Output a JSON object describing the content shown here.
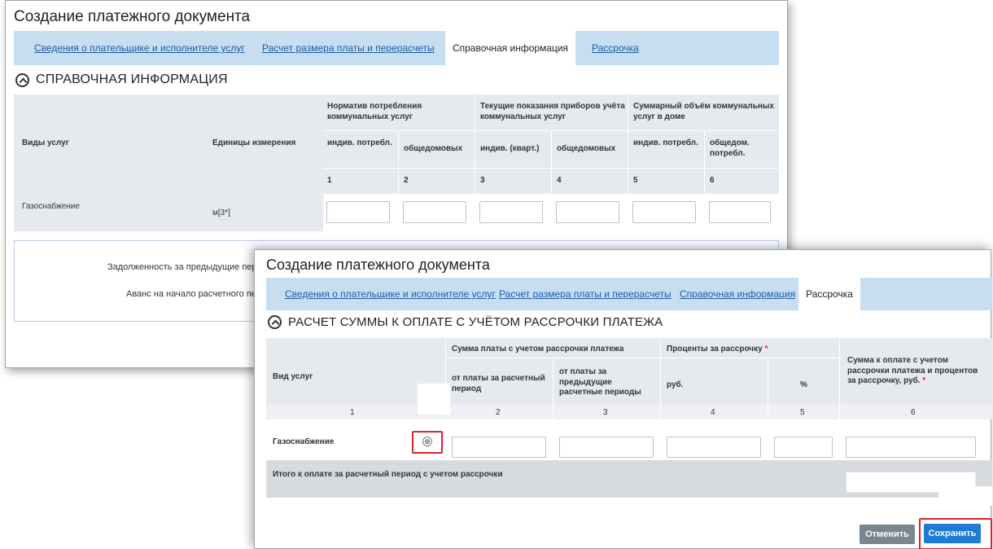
{
  "window_back": {
    "title": "Создание платежного документа",
    "tabs": [
      {
        "label": "Сведения о плательщике и исполнителе услуг",
        "active": false
      },
      {
        "label": "Расчет размера платы и перерасчеты",
        "active": false
      },
      {
        "label": "Справочная информация",
        "active": true
      },
      {
        "label": "Рассрочка",
        "active": false
      }
    ],
    "section_title": "СПРАВОЧНАЯ ИНФОРМАЦИЯ",
    "table": {
      "col_service": "Виды услуг",
      "col_units": "Единицы измерения",
      "group_norm": "Норматив потребления коммунальных услуг",
      "group_current": "Текущие показания приборов учёта коммунальных услуг",
      "group_total": "Суммарный объём коммунальных услуг в доме",
      "sub": [
        "индив. потребл.",
        "общедомовых",
        "индив. (кварт.)",
        "общедомовых",
        "индив. потребл.",
        "общедом. потребл."
      ],
      "nums": [
        "1",
        "2",
        "3",
        "4",
        "5",
        "6"
      ],
      "row_service": "Газоснабжение",
      "row_unit": "м[3*]"
    },
    "debt_label": "Задолженность за предыдущие перио",
    "advance_label": "Аванс на начало расчетного пери"
  },
  "window_front": {
    "title": "Создание платежного документа",
    "tabs": [
      {
        "label": "Сведения о плательщике и исполнителе услуг",
        "active": false
      },
      {
        "label": "Расчет размера платы и перерасчеты",
        "active": false
      },
      {
        "label": "Справочная информация",
        "active": false
      },
      {
        "label": "Рассрочка",
        "active": true
      }
    ],
    "section_title": "РАСЧЕТ СУММЫ К ОПЛАТЕ С УЧЁТОМ РАССРОЧКИ ПЛАТЕЖА",
    "table": {
      "col_service": "Вид услуг",
      "group_sum": "Сумма платы с учетом рассрочки платежа",
      "sub_current": "от платы за расчетный период",
      "sub_prev": "от платы за предыдущие расчетные периоды",
      "group_percent": "Проценты за рассрочку",
      "sub_rub": "руб.",
      "sub_pct": "%",
      "col_total": "Сумма к оплате с учетом рассрочки платежа и процентов за рассрочку, руб.",
      "required_mark": "*",
      "nums": [
        "1",
        "2",
        "3",
        "4",
        "5",
        "6"
      ],
      "row_service": "Газоснабжение",
      "remove_icon": "⊗",
      "total_label": "Итого к оплате за расчетный период с учетом рассрочки"
    },
    "buttons": {
      "cancel": "Отменить",
      "save": "Сохранить"
    }
  },
  "colors": {
    "tabbar": "#c7def0",
    "link": "#1a5aa6",
    "header_bg": "#e6e9ed",
    "highlight": "#e0222a",
    "save": "#1d7bd4",
    "cancel": "#7b858f"
  }
}
